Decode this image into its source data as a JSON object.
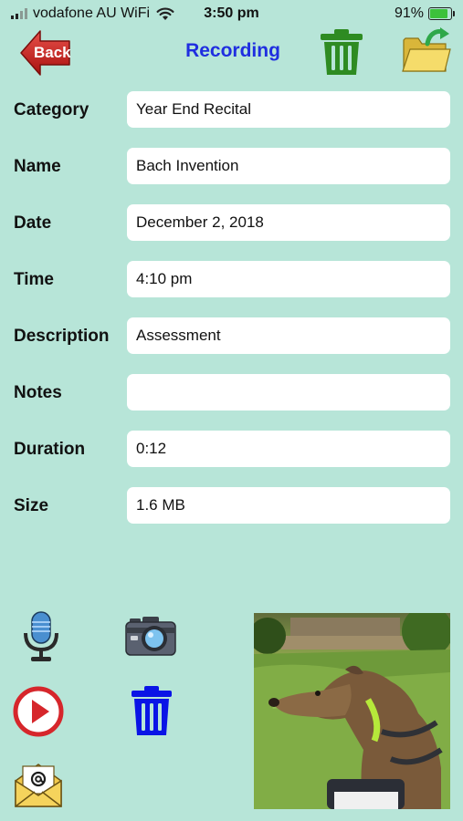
{
  "status_bar": {
    "carrier": "vodafone AU WiFi",
    "time": "3:50 pm",
    "battery": "91%",
    "battery_level": 0.91
  },
  "header": {
    "back_label": "Back",
    "title": "Recording",
    "back_color": "#c8201f",
    "title_color": "#1f2ee0",
    "trash_icon": "trash-icon",
    "open_folder_icon": "folder-open-icon"
  },
  "form": {
    "category": {
      "label": "Category",
      "value": "Year End Recital"
    },
    "name": {
      "label": "Name",
      "value": "Bach Invention"
    },
    "date": {
      "label": "Date",
      "value": "December 2, 2018"
    },
    "time": {
      "label": "Time",
      "value": "4:10 pm"
    },
    "description": {
      "label": "Description",
      "value": "Assessment"
    },
    "notes": {
      "label": "Notes",
      "value": ""
    },
    "duration": {
      "label": "Duration",
      "value": "0:12"
    },
    "size": {
      "label": "Size",
      "value": "1.6 MB"
    }
  },
  "controls": {
    "record_icon": "microphone-icon",
    "camera_icon": "camera-icon",
    "play_icon": "play-icon",
    "delete_icon": "trash-icon",
    "email_icon": "email-icon",
    "photo_subject": "photo-thumbnail"
  },
  "colors": {
    "background": "#b7e5d8",
    "trash_green": "#2e8b22",
    "delete_blue": "#0a14e6",
    "play_red": "#d6262b"
  }
}
